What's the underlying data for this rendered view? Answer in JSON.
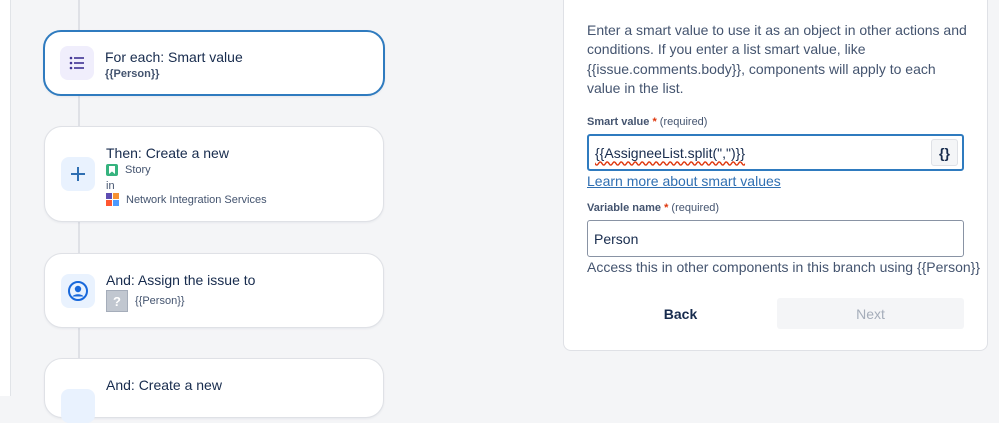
{
  "flow": {
    "cards": [
      {
        "title": "For each: Smart value",
        "sub": "{{Person}}",
        "icon": "list-icon"
      },
      {
        "title": "Then: Create a new",
        "issue_type": "Story",
        "in_label": "in",
        "project": "Network Integration Services",
        "icon": "plus-icon"
      },
      {
        "title": "And: Assign the issue to",
        "assignee": "{{Person}}",
        "icon": "user-circle-icon"
      },
      {
        "title": "And: Create a new",
        "icon": "plus-icon"
      }
    ]
  },
  "panel": {
    "description": "Enter a smart value to use it as an object in other actions and conditions. If you enter a list smart value, like {{issue.comments.body}}, components will apply to each value in the list.",
    "smart_value": {
      "label": "Smart value",
      "required_mark": "*",
      "required_text": "(required)",
      "value": "{{AssigneeList.split(\",\")}}",
      "brace_button": "{}"
    },
    "learn_more_link": "Learn more about smart values",
    "variable_name": {
      "label": "Variable name",
      "required_mark": "*",
      "required_text": "(required)",
      "value": "Person"
    },
    "helper_text": "Access this in other components in this branch using {{Person}}",
    "back_button": "Back",
    "next_button": "Next"
  },
  "colors": {
    "accent": "#2f7bbf",
    "link": "#2f6fb2",
    "required": "#de350b",
    "story_green": "#36b37e"
  }
}
